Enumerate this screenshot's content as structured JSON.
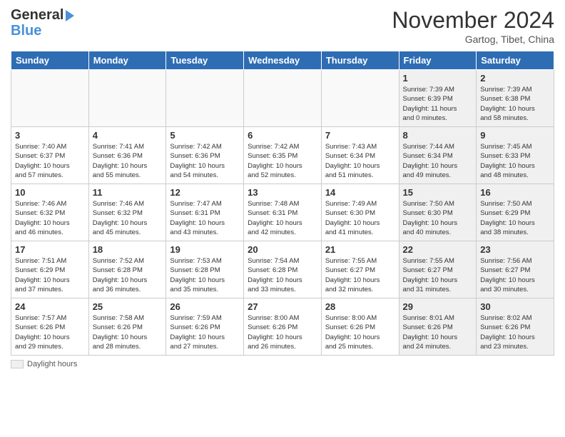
{
  "header": {
    "logo_line1": "General",
    "logo_line2": "Blue",
    "month": "November 2024",
    "location": "Gartog, Tibet, China"
  },
  "days_of_week": [
    "Sunday",
    "Monday",
    "Tuesday",
    "Wednesday",
    "Thursday",
    "Friday",
    "Saturday"
  ],
  "legend_label": "Daylight hours",
  "weeks": [
    [
      {
        "day": "",
        "info": "",
        "empty": true
      },
      {
        "day": "",
        "info": "",
        "empty": true
      },
      {
        "day": "",
        "info": "",
        "empty": true
      },
      {
        "day": "",
        "info": "",
        "empty": true
      },
      {
        "day": "",
        "info": "",
        "empty": true
      },
      {
        "day": "1",
        "info": "Sunrise: 7:39 AM\nSunset: 6:39 PM\nDaylight: 11 hours\nand 0 minutes.",
        "shaded": true
      },
      {
        "day": "2",
        "info": "Sunrise: 7:39 AM\nSunset: 6:38 PM\nDaylight: 10 hours\nand 58 minutes.",
        "shaded": true
      }
    ],
    [
      {
        "day": "3",
        "info": "Sunrise: 7:40 AM\nSunset: 6:37 PM\nDaylight: 10 hours\nand 57 minutes."
      },
      {
        "day": "4",
        "info": "Sunrise: 7:41 AM\nSunset: 6:36 PM\nDaylight: 10 hours\nand 55 minutes."
      },
      {
        "day": "5",
        "info": "Sunrise: 7:42 AM\nSunset: 6:36 PM\nDaylight: 10 hours\nand 54 minutes."
      },
      {
        "day": "6",
        "info": "Sunrise: 7:42 AM\nSunset: 6:35 PM\nDaylight: 10 hours\nand 52 minutes."
      },
      {
        "day": "7",
        "info": "Sunrise: 7:43 AM\nSunset: 6:34 PM\nDaylight: 10 hours\nand 51 minutes."
      },
      {
        "day": "8",
        "info": "Sunrise: 7:44 AM\nSunset: 6:34 PM\nDaylight: 10 hours\nand 49 minutes.",
        "shaded": true
      },
      {
        "day": "9",
        "info": "Sunrise: 7:45 AM\nSunset: 6:33 PM\nDaylight: 10 hours\nand 48 minutes.",
        "shaded": true
      }
    ],
    [
      {
        "day": "10",
        "info": "Sunrise: 7:46 AM\nSunset: 6:32 PM\nDaylight: 10 hours\nand 46 minutes."
      },
      {
        "day": "11",
        "info": "Sunrise: 7:46 AM\nSunset: 6:32 PM\nDaylight: 10 hours\nand 45 minutes."
      },
      {
        "day": "12",
        "info": "Sunrise: 7:47 AM\nSunset: 6:31 PM\nDaylight: 10 hours\nand 43 minutes."
      },
      {
        "day": "13",
        "info": "Sunrise: 7:48 AM\nSunset: 6:31 PM\nDaylight: 10 hours\nand 42 minutes."
      },
      {
        "day": "14",
        "info": "Sunrise: 7:49 AM\nSunset: 6:30 PM\nDaylight: 10 hours\nand 41 minutes."
      },
      {
        "day": "15",
        "info": "Sunrise: 7:50 AM\nSunset: 6:30 PM\nDaylight: 10 hours\nand 40 minutes.",
        "shaded": true
      },
      {
        "day": "16",
        "info": "Sunrise: 7:50 AM\nSunset: 6:29 PM\nDaylight: 10 hours\nand 38 minutes.",
        "shaded": true
      }
    ],
    [
      {
        "day": "17",
        "info": "Sunrise: 7:51 AM\nSunset: 6:29 PM\nDaylight: 10 hours\nand 37 minutes."
      },
      {
        "day": "18",
        "info": "Sunrise: 7:52 AM\nSunset: 6:28 PM\nDaylight: 10 hours\nand 36 minutes."
      },
      {
        "day": "19",
        "info": "Sunrise: 7:53 AM\nSunset: 6:28 PM\nDaylight: 10 hours\nand 35 minutes."
      },
      {
        "day": "20",
        "info": "Sunrise: 7:54 AM\nSunset: 6:28 PM\nDaylight: 10 hours\nand 33 minutes."
      },
      {
        "day": "21",
        "info": "Sunrise: 7:55 AM\nSunset: 6:27 PM\nDaylight: 10 hours\nand 32 minutes."
      },
      {
        "day": "22",
        "info": "Sunrise: 7:55 AM\nSunset: 6:27 PM\nDaylight: 10 hours\nand 31 minutes.",
        "shaded": true
      },
      {
        "day": "23",
        "info": "Sunrise: 7:56 AM\nSunset: 6:27 PM\nDaylight: 10 hours\nand 30 minutes.",
        "shaded": true
      }
    ],
    [
      {
        "day": "24",
        "info": "Sunrise: 7:57 AM\nSunset: 6:26 PM\nDaylight: 10 hours\nand 29 minutes."
      },
      {
        "day": "25",
        "info": "Sunrise: 7:58 AM\nSunset: 6:26 PM\nDaylight: 10 hours\nand 28 minutes."
      },
      {
        "day": "26",
        "info": "Sunrise: 7:59 AM\nSunset: 6:26 PM\nDaylight: 10 hours\nand 27 minutes."
      },
      {
        "day": "27",
        "info": "Sunrise: 8:00 AM\nSunset: 6:26 PM\nDaylight: 10 hours\nand 26 minutes."
      },
      {
        "day": "28",
        "info": "Sunrise: 8:00 AM\nSunset: 6:26 PM\nDaylight: 10 hours\nand 25 minutes."
      },
      {
        "day": "29",
        "info": "Sunrise: 8:01 AM\nSunset: 6:26 PM\nDaylight: 10 hours\nand 24 minutes.",
        "shaded": true
      },
      {
        "day": "30",
        "info": "Sunrise: 8:02 AM\nSunset: 6:26 PM\nDaylight: 10 hours\nand 23 minutes.",
        "shaded": true
      }
    ]
  ]
}
